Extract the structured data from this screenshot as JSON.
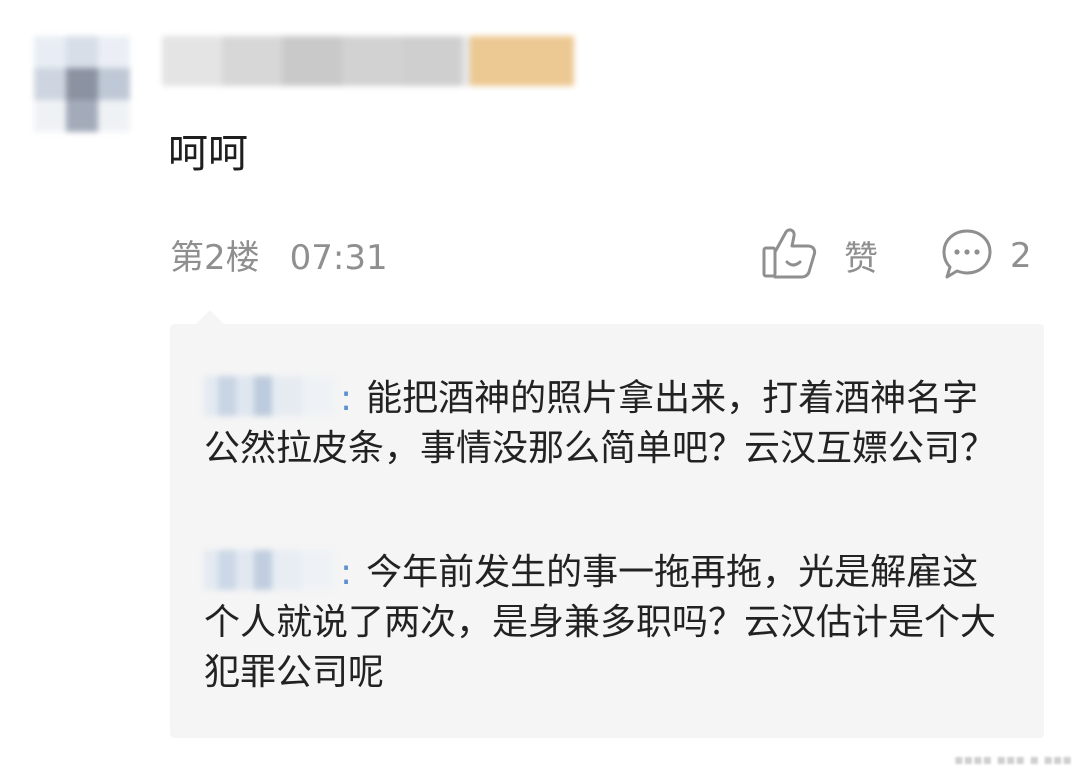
{
  "comment": {
    "text": "呵呵",
    "floor": "第2楼",
    "time": "07:31",
    "like_label": "赞",
    "reply_count": "2"
  },
  "replies": [
    {
      "separator": ":",
      "text": "能把酒神的照片拿出来，打着酒神名字公然拉皮条，事情没那么简单吧？云汉互嫖公司？"
    },
    {
      "separator": ":",
      "text": "今年前发生的事一拖再拖，光是解雇这个人就说了两次，是身兼多职吗？云汉估计是个大犯罪公司呢"
    }
  ],
  "colors": {
    "meta_gray": "#8f8f8f",
    "reply_background": "#f5f5f5",
    "username_link": "#5b8fd0"
  },
  "icons": [
    "thumbs-up-icon",
    "comment-bubble-icon"
  ]
}
